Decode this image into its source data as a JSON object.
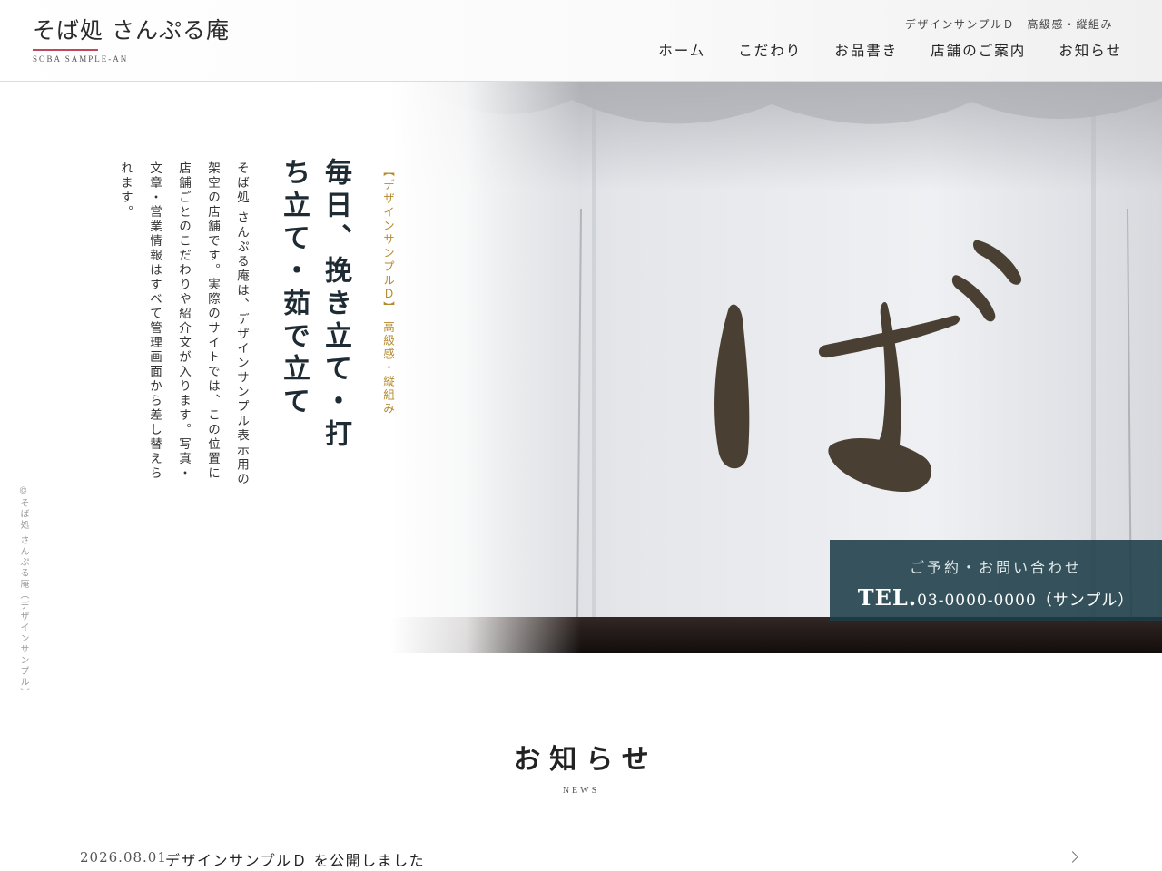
{
  "header": {
    "logo_title": "そば処 さんぷる庵",
    "logo_sub": "SOBA SAMPLE-AN",
    "tagline": "デザインサンプルＤ　高級感・縦組み",
    "nav": [
      {
        "label": "ホーム"
      },
      {
        "label": "こだわり"
      },
      {
        "label": "お品書き"
      },
      {
        "label": "店舗のご案内"
      },
      {
        "label": "お知らせ"
      }
    ]
  },
  "hero": {
    "label": "【デザインサンプルＤ】 高級感・縦組み",
    "catch": "毎日、挽き立て・打ち立て・茹で立て",
    "body": "そば処 さんぷる庵は、デザインサンプル表示用の架空の店舗です。実際のサイトでは、この位置に店舗ごとのこだわりや紹介文が入ります。写真・文章・営業情報はすべて管理画面から差し替えられます。",
    "copyright": "©そば処 さんぷる庵（デザインサンプル）",
    "noren_text": "ば"
  },
  "reserve": {
    "label": "ご予約・お問い合わせ",
    "tel_prefix": "TEL.",
    "tel_number": "03-0000-0000",
    "tel_suffix": "（サンプル）"
  },
  "news": {
    "title": "お知らせ",
    "title_en": "NEWS",
    "items": [
      {
        "date": "2026.08.01",
        "text": "デザインサンプルＤ を公開しました"
      }
    ]
  },
  "colors": {
    "accent_red": "#c0485a",
    "gold": "#b48a2e",
    "reserve_bg": "#1c3c48"
  }
}
